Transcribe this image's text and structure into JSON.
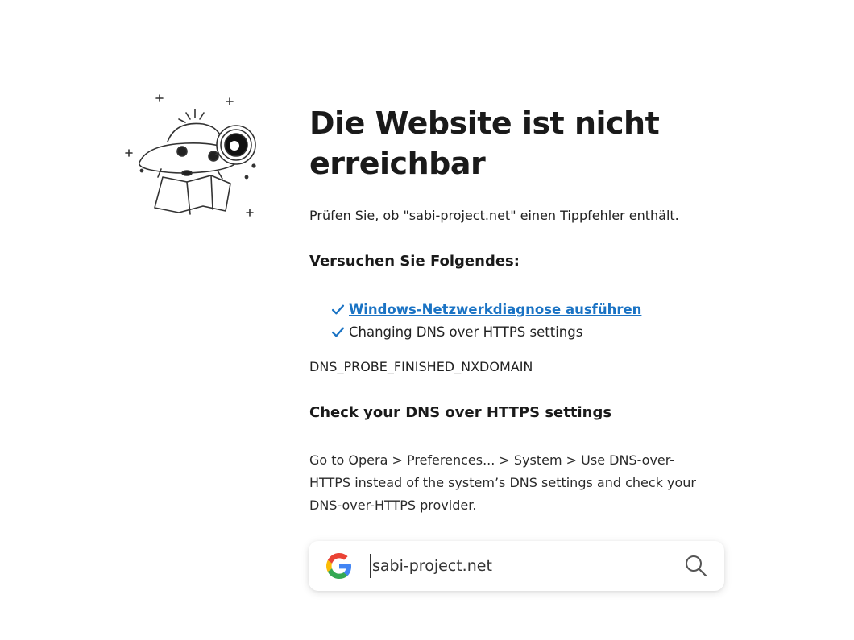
{
  "page": {
    "title": "Die Website ist nicht erreichbar",
    "typo_hint": "Prüfen Sie, ob \"sabi-project.net\" einen Tippfehler enthält.",
    "try_heading": "Versuchen Sie Folgendes:",
    "suggestions": [
      {
        "label": "Windows-Netzwerkdiagnose ausführen",
        "is_link": true
      },
      {
        "label": "Changing DNS over HTTPS settings",
        "is_link": false
      }
    ],
    "error_code": "DNS_PROBE_FINISHED_NXDOMAIN",
    "doh_heading": "Check your DNS over HTTPS settings",
    "doh_text": "Go to Opera > Preferences... > System > Use DNS-over-HTTPS instead of the system’s DNS settings and check your DNS-over-HTTPS provider."
  },
  "search": {
    "value": "sabi-project.net",
    "engine_icon": "google-icon",
    "button_icon": "search-icon"
  },
  "illustration": {
    "icon": "ufo-telescope-illustration"
  },
  "colors": {
    "link": "#1a73c4",
    "check": "#1a73c4",
    "text": "#1f1f1f"
  }
}
